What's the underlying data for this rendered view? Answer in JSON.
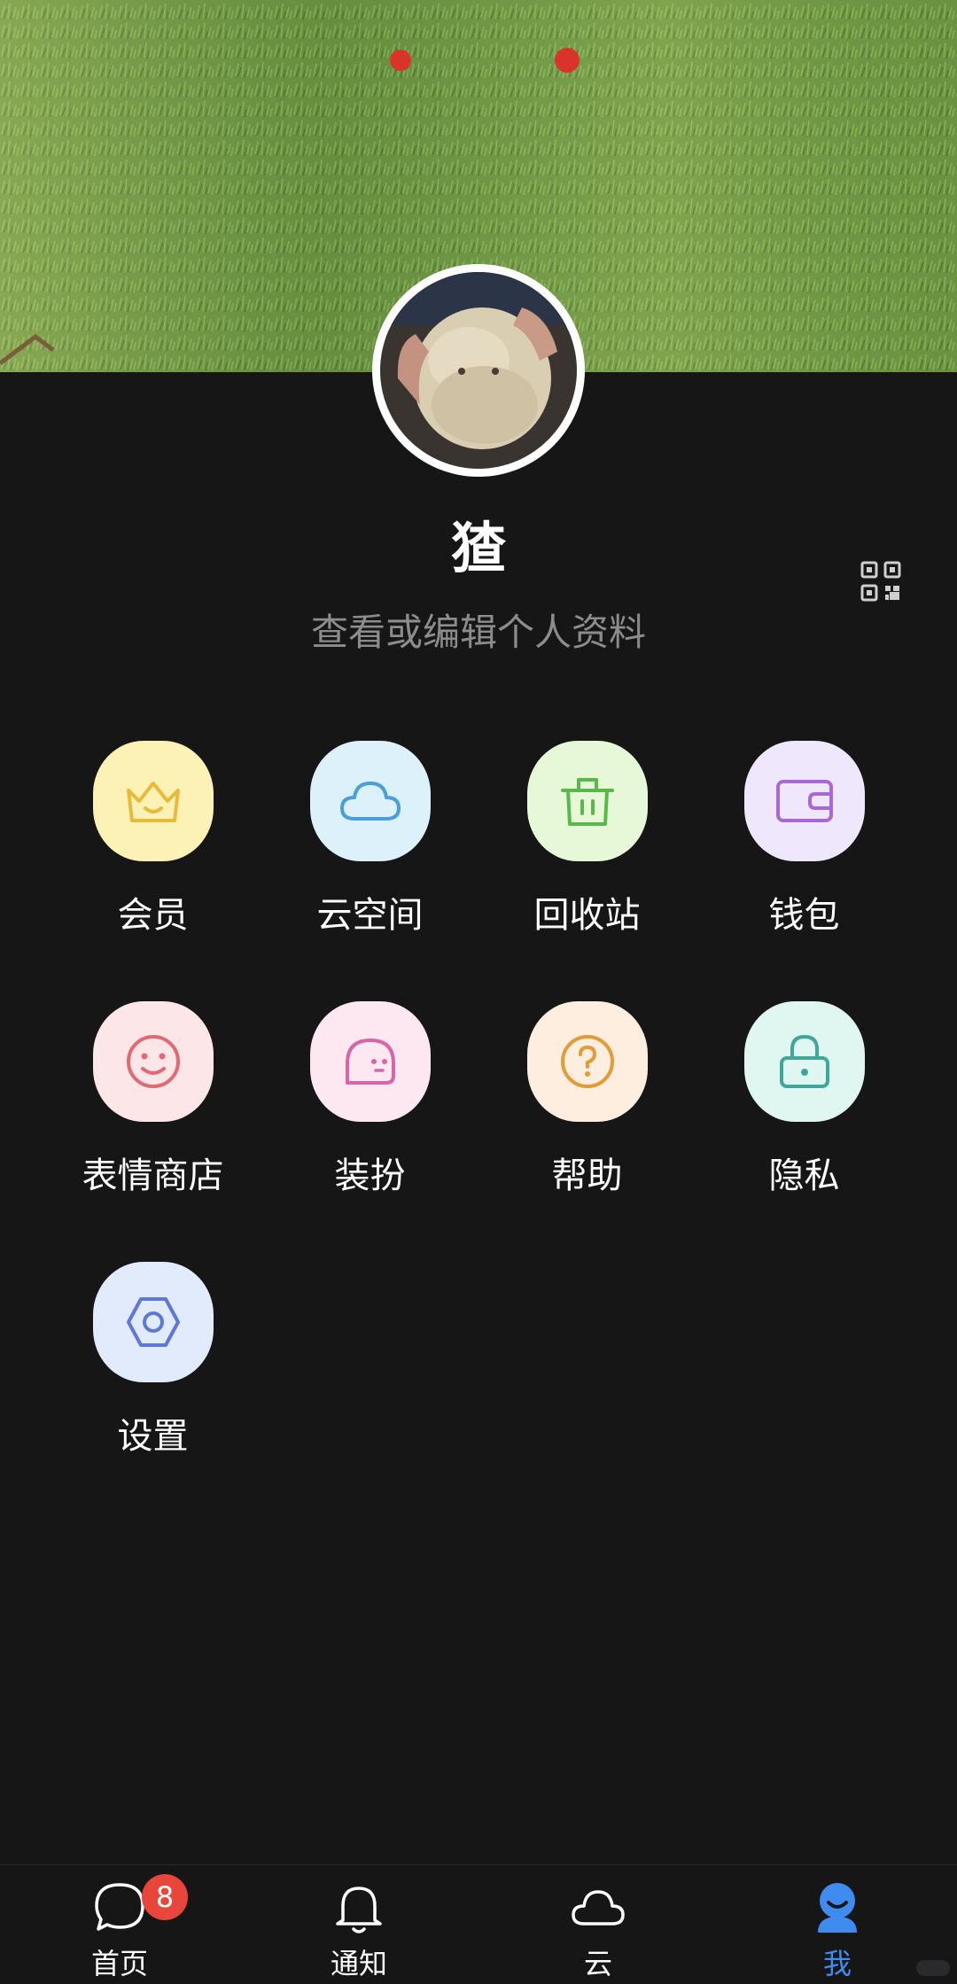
{
  "profile": {
    "name": "猹",
    "edit_prompt": "查看或编辑个人资料"
  },
  "grid": {
    "items": [
      {
        "label": "会员",
        "icon": "crown-icon",
        "bg": "#fdf2b5",
        "fg": "#e9b93a"
      },
      {
        "label": "云空间",
        "icon": "cloud-icon",
        "bg": "#ddf1fb",
        "fg": "#4a9fd9"
      },
      {
        "label": "回收站",
        "icon": "trash-icon",
        "bg": "#e6f8d8",
        "fg": "#58b84a"
      },
      {
        "label": "钱包",
        "icon": "wallet-icon",
        "bg": "#efe7fb",
        "fg": "#a968d6"
      },
      {
        "label": "表情商店",
        "icon": "smiley-icon",
        "bg": "#fde6e8",
        "fg": "#e06a72"
      },
      {
        "label": "装扮",
        "icon": "blob-face-icon",
        "bg": "#fde8f2",
        "fg": "#d666a8"
      },
      {
        "label": "帮助",
        "icon": "help-icon",
        "bg": "#fdeedf",
        "fg": "#e29b35"
      },
      {
        "label": "隐私",
        "icon": "lock-icon",
        "bg": "#dff6f1",
        "fg": "#3fa79a"
      },
      {
        "label": "设置",
        "icon": "settings-icon",
        "bg": "#e2ebfb",
        "fg": "#5d79d6"
      }
    ]
  },
  "tabbar": {
    "tabs": [
      {
        "label": "首页",
        "icon": "chat-bubble-icon",
        "badge": "8"
      },
      {
        "label": "通知",
        "icon": "bell-icon"
      },
      {
        "label": "云",
        "icon": "cloud-icon"
      },
      {
        "label": "我",
        "icon": "user-icon",
        "active": true
      }
    ]
  },
  "colors": {
    "background": "#161617",
    "accent": "#3f8cf0",
    "badge": "#e9463b"
  }
}
